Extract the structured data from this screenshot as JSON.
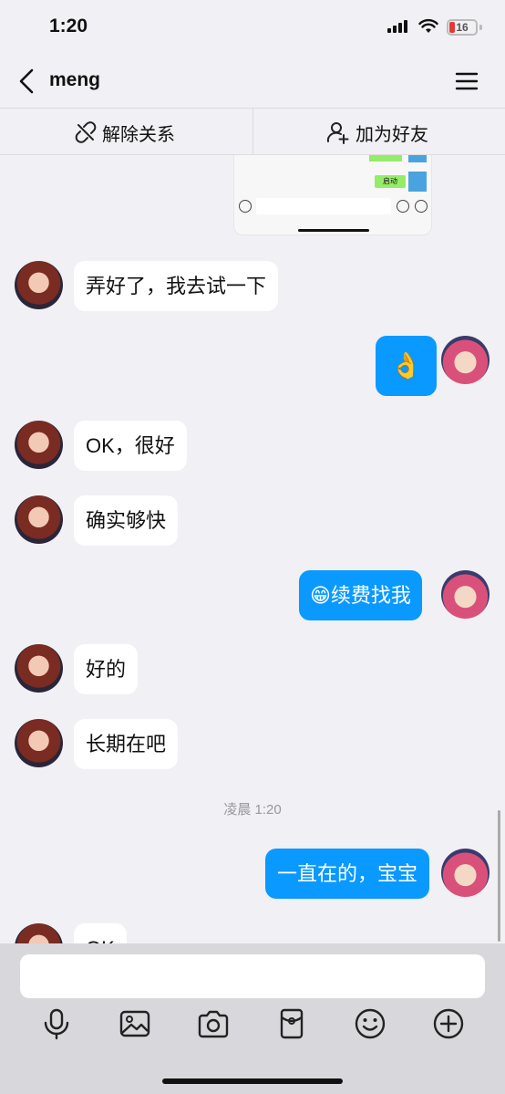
{
  "status_bar": {
    "time": "1:20",
    "battery": "16"
  },
  "header": {
    "title": "meng"
  },
  "actions": {
    "unbind_label": "解除关系",
    "add_friend_label": "加为好友"
  },
  "shared_screenshot": {
    "button_label": "启动"
  },
  "messages": [
    {
      "from": "her",
      "text": "弄好了，我去试一下"
    },
    {
      "from": "me",
      "text": "👌"
    },
    {
      "from": "her",
      "text": "OK，很好"
    },
    {
      "from": "her",
      "text": "确实够快"
    },
    {
      "from": "me",
      "text": "😁续费找我"
    },
    {
      "from": "her",
      "text": "好的"
    },
    {
      "from": "her",
      "text": "长期在吧"
    },
    {
      "from": "me",
      "text": "一直在的，宝宝"
    },
    {
      "from": "her",
      "text": "OK"
    }
  ],
  "timestamp": "凌晨 1:20",
  "colors": {
    "my_bubble": "#0a99ff",
    "her_bubble": "#ffffff",
    "background": "#f0f0f5"
  },
  "toolbar_icons": [
    "mic-icon",
    "image-icon",
    "camera-icon",
    "red-packet-icon",
    "emoji-icon",
    "plus-icon"
  ]
}
